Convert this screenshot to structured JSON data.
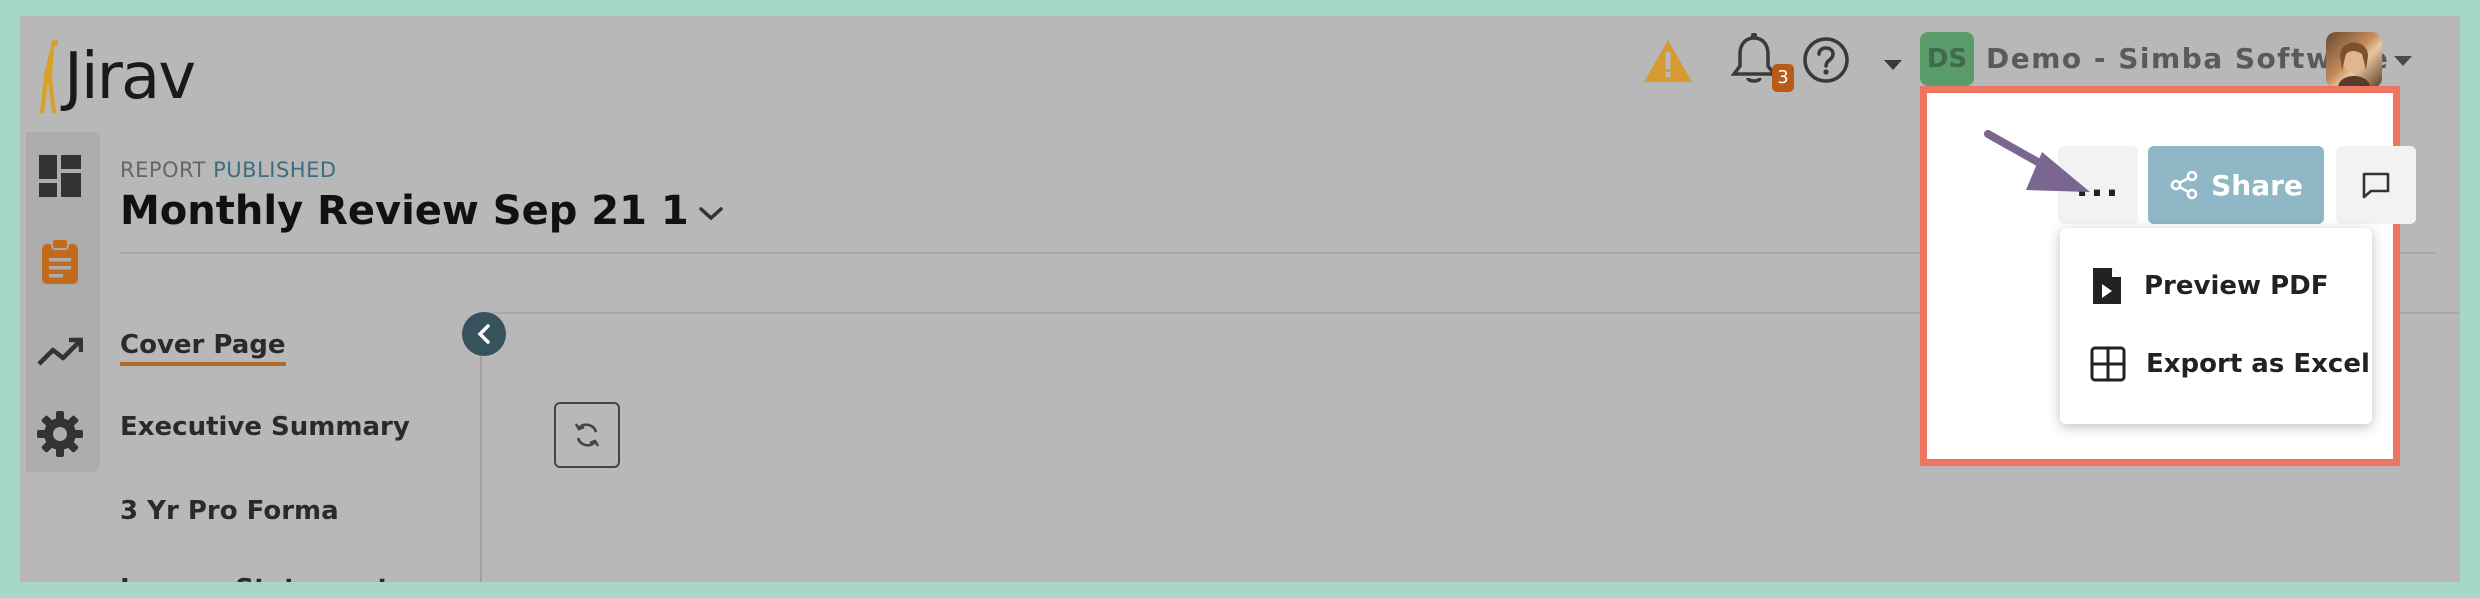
{
  "app": {
    "logo_text": "Jirav"
  },
  "header": {
    "notification_count": "3",
    "user_initials": "DS",
    "company_name": "Demo - Simba Software"
  },
  "report": {
    "status_prefix": "REPORT",
    "status": "PUBLISHED",
    "title": "Monthly Review Sep 21 1"
  },
  "nav": {
    "items": [
      {
        "label": "Cover Page"
      },
      {
        "label": "Executive Summary"
      },
      {
        "label": "3 Yr Pro Forma"
      },
      {
        "label": "Income Statement"
      }
    ]
  },
  "toolbar": {
    "more_label": "...",
    "share_label": "Share"
  },
  "menu": {
    "items": [
      {
        "label": "Preview PDF",
        "icon": "file-pdf-icon"
      },
      {
        "label": "Export as Excel",
        "icon": "grid-icon"
      }
    ]
  },
  "colors": {
    "highlight": "#ec7660",
    "share_button": "#8fb7c6",
    "arrow": "#7a6690",
    "warning": "#d79a30",
    "badge": "#b85a1a"
  }
}
